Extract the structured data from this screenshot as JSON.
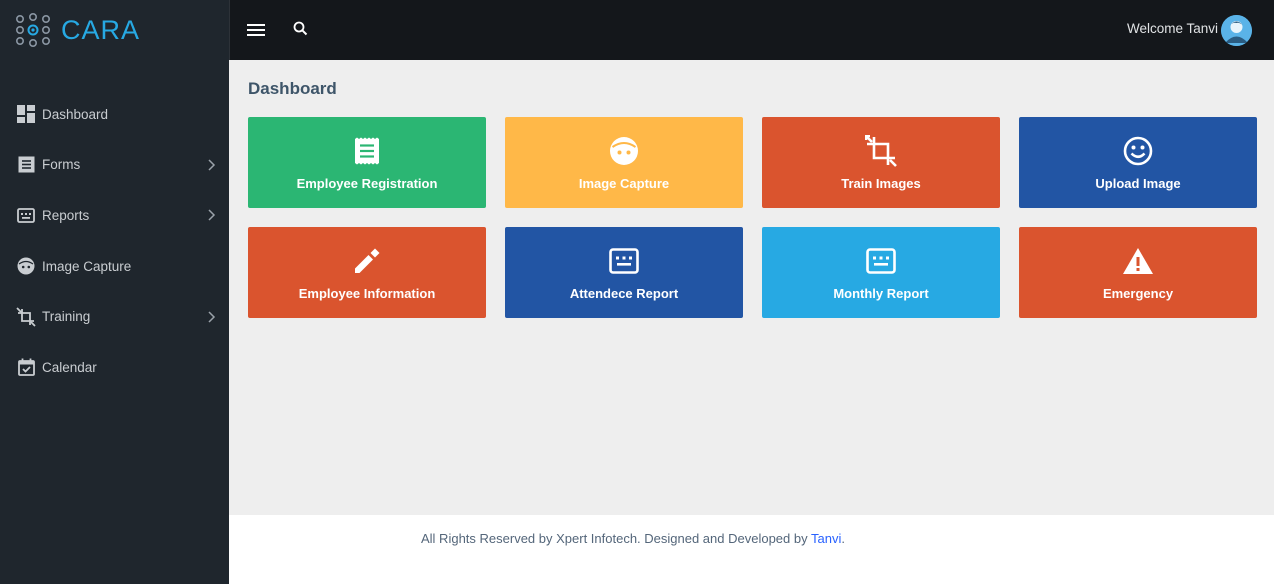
{
  "brand": {
    "name": "CARA"
  },
  "sidebar": {
    "items": [
      {
        "label": "Dashboard",
        "icon": "dashboard-icon",
        "has_submenu": false
      },
      {
        "label": "Forms",
        "icon": "receipt-icon",
        "has_submenu": true
      },
      {
        "label": "Reports",
        "icon": "keyboard-icon",
        "has_submenu": true
      },
      {
        "label": "Image Capture",
        "icon": "face-icon",
        "has_submenu": false
      },
      {
        "label": "Training",
        "icon": "crop-rotate-icon",
        "has_submenu": true
      },
      {
        "label": "Calendar",
        "icon": "calendar-check-icon",
        "has_submenu": false
      }
    ]
  },
  "topbar": {
    "welcome": "Welcome Tanvi"
  },
  "main": {
    "title": "Dashboard",
    "tiles": [
      {
        "label": "Employee Registration",
        "icon": "receipt-icon",
        "color": "#2bb673"
      },
      {
        "label": "Image Capture",
        "icon": "face-icon",
        "color": "#ffb848"
      },
      {
        "label": "Train Images",
        "icon": "crop-rotate-icon",
        "color": "#da542e"
      },
      {
        "label": "Upload Image",
        "icon": "smiley-icon",
        "color": "#2255a4"
      },
      {
        "label": "Employee Information",
        "icon": "pencil-icon",
        "color": "#da542e"
      },
      {
        "label": "Attendece Report",
        "icon": "keyboard-icon",
        "color": "#2255a4"
      },
      {
        "label": "Monthly Report",
        "icon": "keyboard-icon",
        "color": "#27a9e3"
      },
      {
        "label": "Emergency",
        "icon": "warning-icon",
        "color": "#da542e"
      }
    ]
  },
  "footer": {
    "text": "All Rights Reserved by Xpert Infotech. Designed and Developed by ",
    "link": "Tanvi",
    "suffix": "."
  },
  "colors": {
    "sidebar_bg": "#1f262d",
    "topbar_bg": "#14171b",
    "brand_accent": "#27a9e3",
    "green": "#2bb673",
    "orange": "#ffb848",
    "red": "#da542e",
    "blue": "#2255a4",
    "cyan": "#27a9e3"
  }
}
